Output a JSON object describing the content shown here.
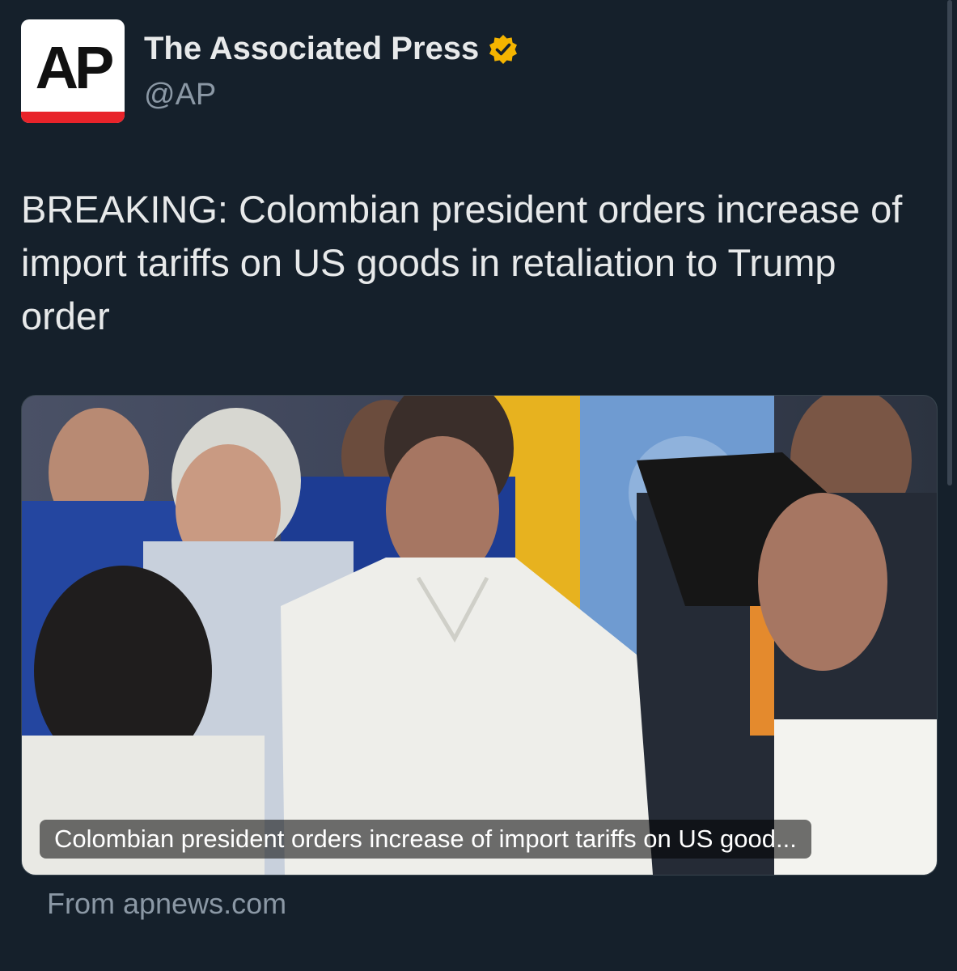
{
  "account": {
    "avatar_text": "AP",
    "display_name": "The Associated Press",
    "handle": "@AP",
    "verified": true,
    "verified_color": "#f4b400"
  },
  "tweet": {
    "text": "BREAKING: Colombian president orders increase of import tariffs on US goods in retaliation to Trump order"
  },
  "link_card": {
    "title": "Colombian president orders increase of import tariffs on US good...",
    "source": "From apnews.com"
  },
  "colors": {
    "background": "#15202b",
    "text": "#e7e9ea",
    "muted": "#8b98a5",
    "ap_red": "#e8232a"
  }
}
